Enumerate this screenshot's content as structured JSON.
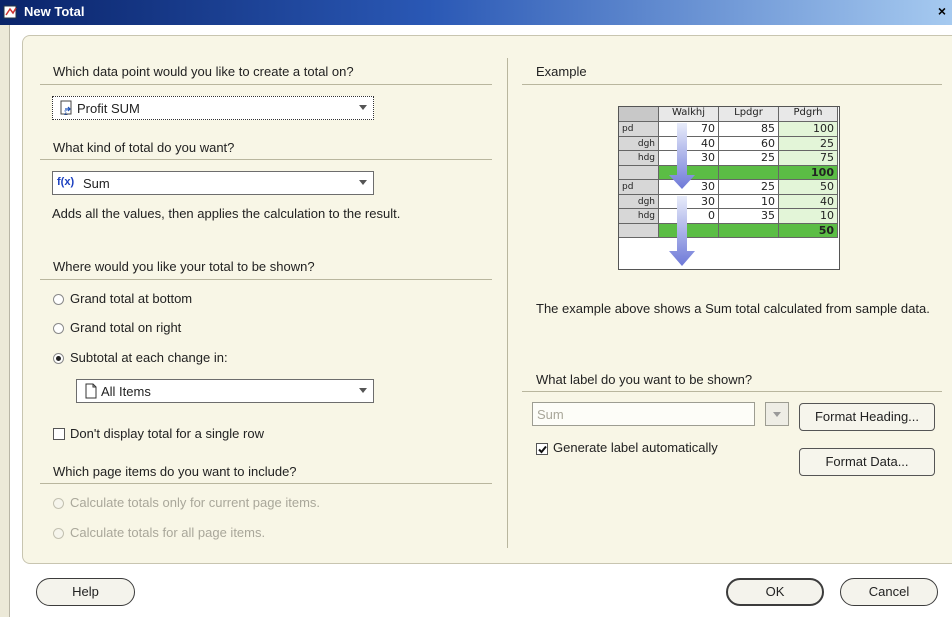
{
  "window": {
    "title": "New Total",
    "close": "×"
  },
  "data_point": {
    "question": "Which data point would you like to create a total on?",
    "selected": "Profit SUM"
  },
  "total_kind": {
    "question": "What kind of total do you want?",
    "selected": "Sum",
    "icon_text": "f(x)",
    "description": "Adds all the values, then applies the calculation to the result."
  },
  "placement": {
    "question": "Where would you like your total to be shown?",
    "options": [
      {
        "label": "Grand total at bottom",
        "selected": false
      },
      {
        "label": "Grand total on right",
        "selected": false
      },
      {
        "label": "Subtotal at each change in:",
        "selected": true
      }
    ],
    "subtotal_item": "All Items",
    "single_row_label": "Don't display total for a single row"
  },
  "page_items": {
    "question": "Which page items do you want to include?",
    "options": [
      {
        "label": "Calculate totals only for current page items.",
        "enabled": false
      },
      {
        "label": "Calculate totals for all page items.",
        "enabled": false
      }
    ]
  },
  "example": {
    "heading": "Example",
    "columns": [
      "Walkhj",
      "Lpdgr",
      "Pdgrh"
    ],
    "rows": [
      {
        "label": "pd",
        "vals": [
          "70",
          "85",
          "100"
        ]
      },
      {
        "label": "dgh",
        "vals": [
          "40",
          "60",
          "25"
        ]
      },
      {
        "label": "hdg",
        "vals": [
          "30",
          "25",
          "75"
        ]
      },
      {
        "label": "",
        "vals": [
          "",
          "",
          "100"
        ],
        "total": true
      },
      {
        "label": "pd",
        "vals": [
          "30",
          "25",
          "50"
        ]
      },
      {
        "label": "dgh",
        "vals": [
          "30",
          "10",
          "40"
        ]
      },
      {
        "label": "hdg",
        "vals": [
          "0",
          "35",
          "10"
        ]
      },
      {
        "label": "",
        "vals": [
          "",
          "",
          "50"
        ],
        "total": true
      }
    ],
    "caption": "The example above shows a Sum total calculated from sample data."
  },
  "label_section": {
    "question": "What label do you want to be shown?",
    "label_value": "Sum",
    "generate_auto": "Generate label automatically",
    "format_heading": "Format Heading...",
    "format_data": "Format Data..."
  },
  "buttons": {
    "help": "Help",
    "ok": "OK",
    "cancel": "Cancel"
  },
  "colors": {
    "title_start": "#0a246a",
    "title_end": "#a6caf0",
    "total_green": "#5bbd45",
    "panel": "#f8f6e6"
  }
}
